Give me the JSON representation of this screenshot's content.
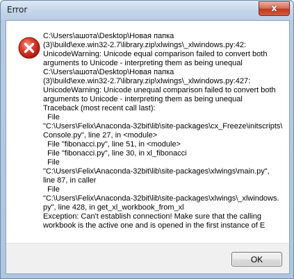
{
  "window": {
    "title": "Error",
    "close_symbol": "x"
  },
  "dialog": {
    "icon": "error-icon",
    "message_lines": [
      "C:\\Users\\ашота\\Desktop\\Новая папка",
      "(3)\\build\\exe.win32-2.7\\library.zip\\xlwings\\_xlwindows.py:42:",
      "UnicodeWarning: Unicode equal comparison failed to convert both",
      "arguments to Unicode - interpreting them as being unequal",
      "C:\\Users\\ашота\\Desktop\\Новая папка",
      "(3)\\build\\exe.win32-2.7\\library.zip\\xlwings\\_xlwindows.py:427:",
      "UnicodeWarning: Unicode unequal comparison failed to convert both",
      "arguments to Unicode - interpreting them as being unequal",
      "Traceback (most recent call last):",
      "  File",
      "\"C:\\Users\\Felix\\Anaconda-32bit\\lib\\site-packages\\cx_Freeze\\initscripts\\",
      "Console.py\", line 27, in <module>",
      "  File \"fibonacci.py\", line 51, in <module>",
      "  File \"fibonacci.py\", line 30, in xl_fibonacci",
      "  File",
      "\"C:\\Users\\Felix\\Anaconda-32bit\\lib\\site-packages\\xlwings\\main.py\",",
      "line 87, in caller",
      "  File",
      "\"C:\\Users\\Felix\\Anaconda-32bit\\lib\\site-packages\\xlwings\\_xlwindows.",
      "py\", line 428, in get_xl_workbook_from_xl",
      "Exception: Can't establish connection! Make sure that the calling",
      "workbook is the active one and is opened in the first instance of E"
    ],
    "ok_label": "OK"
  },
  "colors": {
    "titlebar": "#c3d5ea",
    "close_button": "#c0391f",
    "error_icon": "#d0271c",
    "footer": "#f0f0f0"
  }
}
